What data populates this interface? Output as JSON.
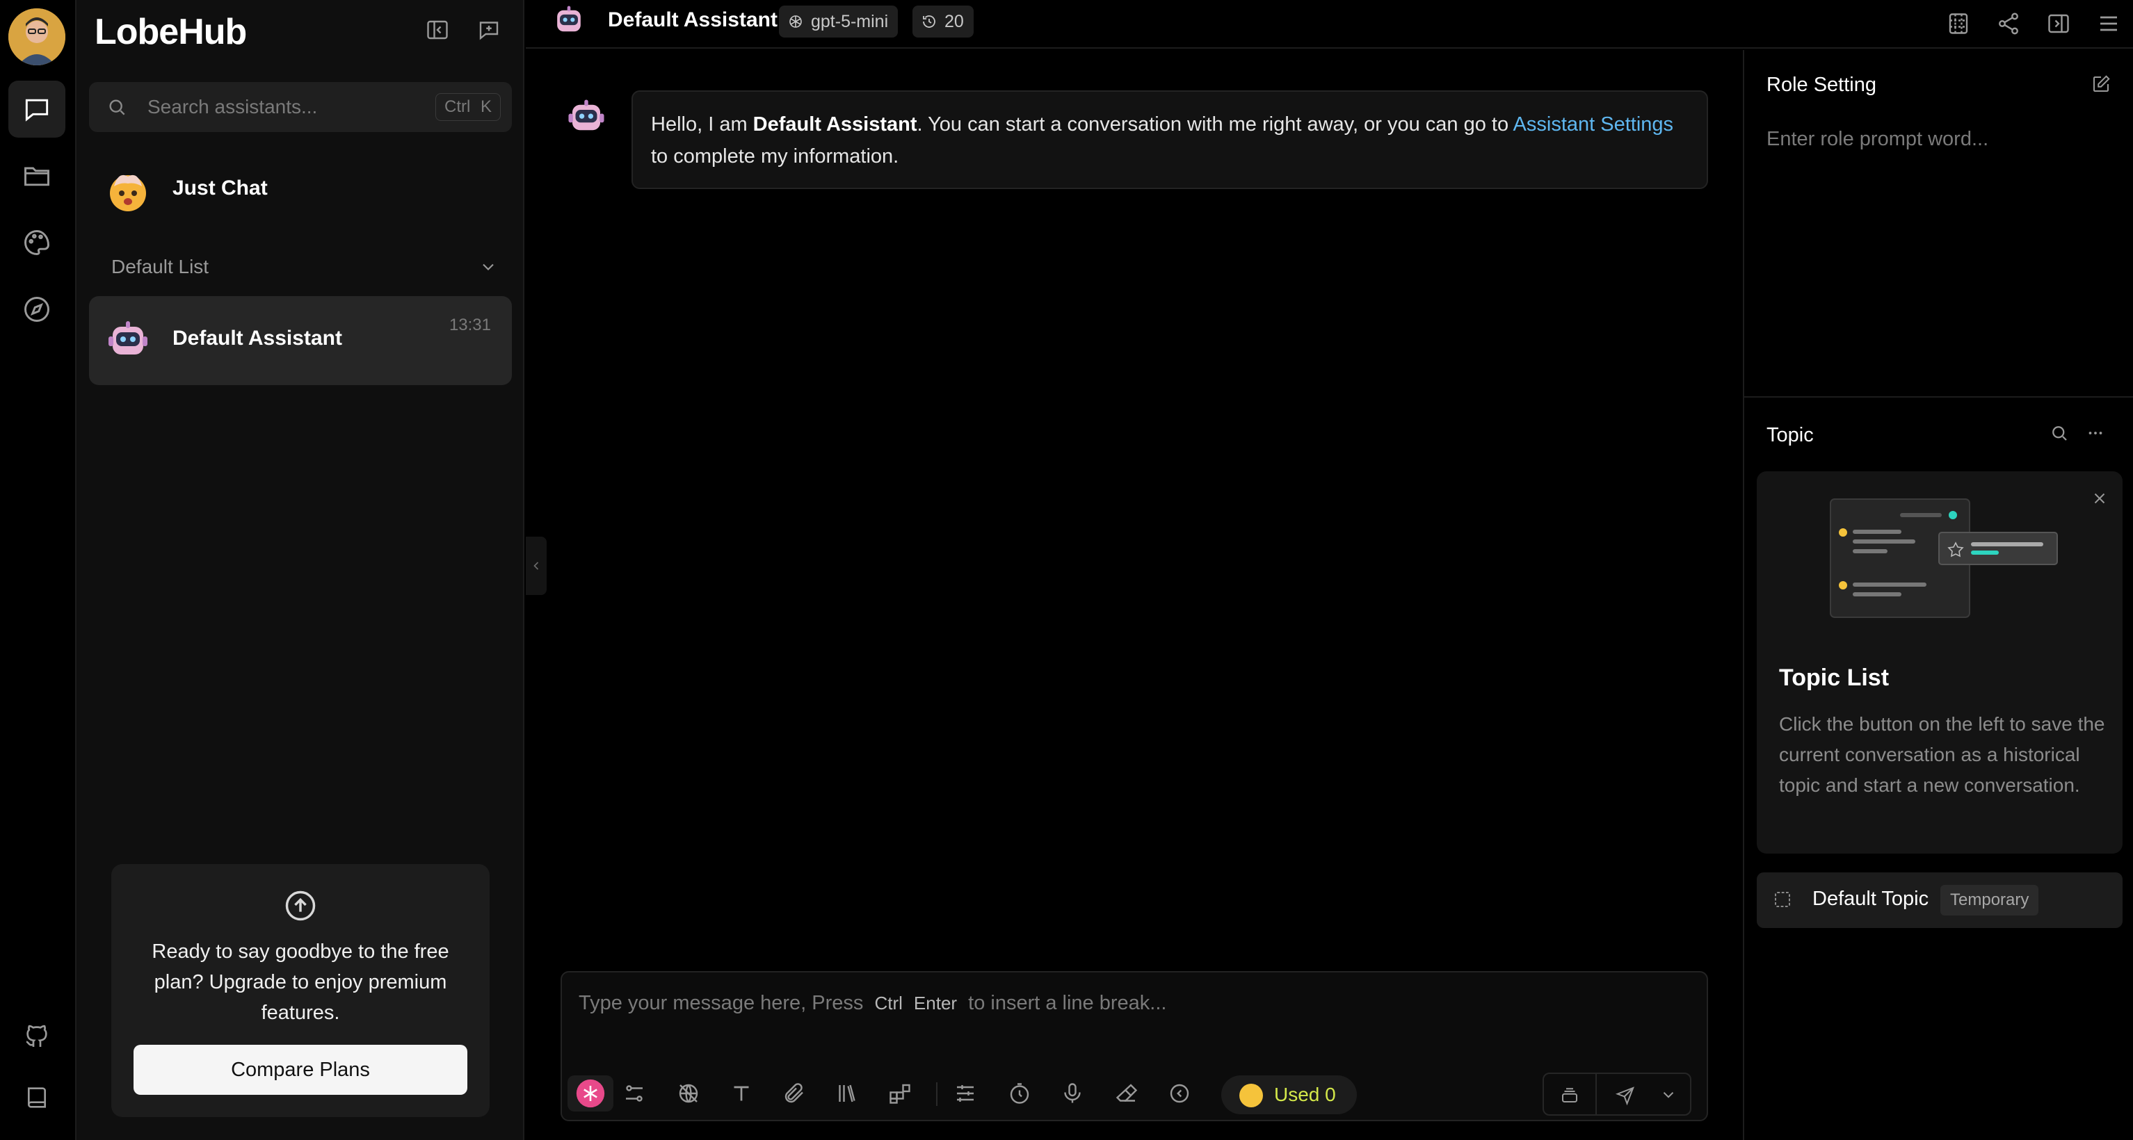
{
  "app": {
    "brand": "LobeHub"
  },
  "colors": {
    "accent_link": "#5fb7f0",
    "used_text": "#d4e84a",
    "background": "#000000"
  },
  "rail": {
    "items": [
      {
        "name": "chat",
        "icon": "chat-icon",
        "active": true
      },
      {
        "name": "files",
        "icon": "folder-icon",
        "active": false
      },
      {
        "name": "image",
        "icon": "palette-icon",
        "active": false
      },
      {
        "name": "discover",
        "icon": "compass-icon",
        "active": false
      }
    ],
    "bottom": [
      {
        "icon": "github-icon"
      },
      {
        "icon": "book-icon"
      }
    ]
  },
  "sidebar": {
    "search_placeholder": "Search assistants...",
    "search_shortcut": "Ctrl K",
    "inbox_label": "Just Chat",
    "group_label": "Default List",
    "assistants": [
      {
        "name": "Default Assistant",
        "time": "13:31",
        "active": true
      }
    ],
    "upgrade_text": "Ready to say goodbye to the free plan? Upgrade to enjoy premium features.",
    "upgrade_button": "Compare Plans"
  },
  "topbar": {
    "title": "Default Assistant",
    "model": "gpt-5-mini",
    "history_count": "20"
  },
  "chat": {
    "greeting_pre": "Hello, I am ",
    "greeting_name": "Default Assistant",
    "greeting_mid": ". You can start a conversation with me right away, or you can go to ",
    "greeting_link": "Assistant Settings",
    "greeting_post": " to complete my information."
  },
  "composer": {
    "placeholder_pre": "Type your message here, Press",
    "key1": "Ctrl",
    "key2": "Enter",
    "placeholder_post": "to insert a line break...",
    "used_label": "Used 0"
  },
  "right_panel": {
    "role_title": "Role Setting",
    "role_placeholder": "Enter role prompt word...",
    "topic_title": "Topic",
    "empty_title": "Topic List",
    "empty_desc": "Click the button on the left to save the current conversation as a historical topic and start a new conversation.",
    "topics": [
      {
        "name": "Default Topic",
        "badge": "Temporary"
      }
    ]
  }
}
